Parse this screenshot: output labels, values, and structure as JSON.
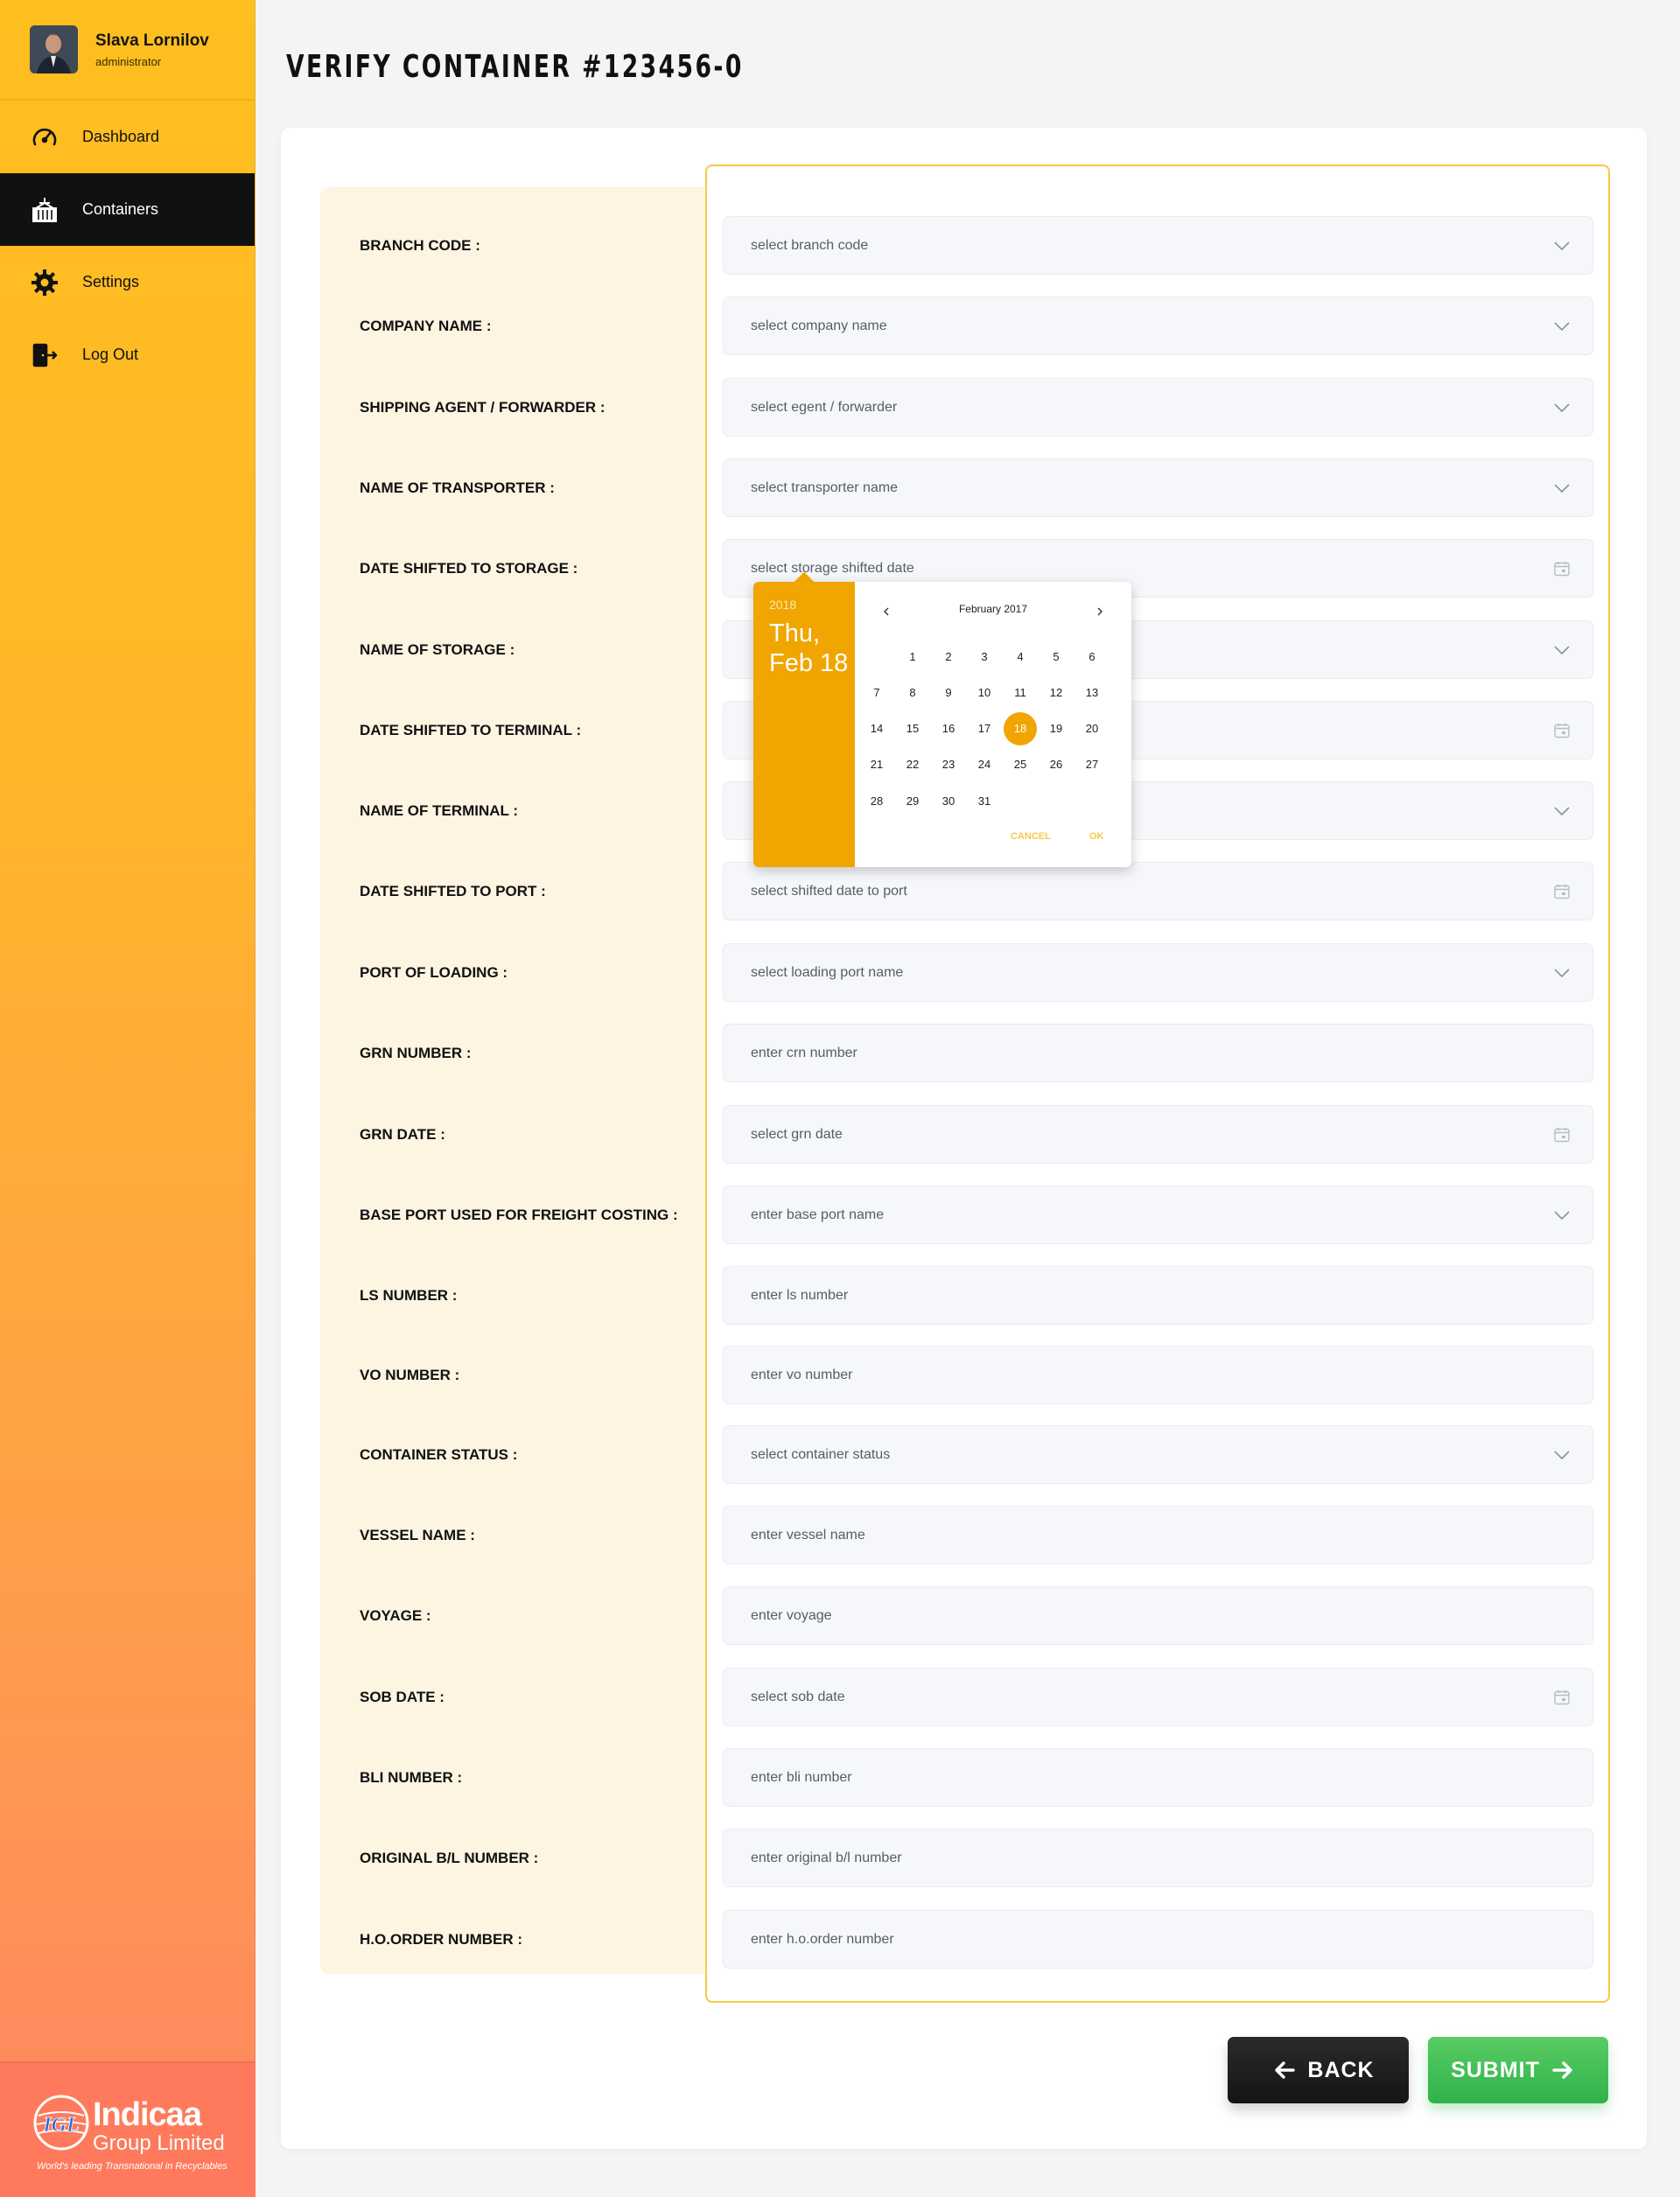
{
  "user": {
    "name": "Slava Lornilov",
    "role": "administrator"
  },
  "nav": [
    {
      "label": "Dashboard",
      "icon": "speedometer-icon",
      "active": false
    },
    {
      "label": "Containers",
      "icon": "container-icon",
      "active": true
    },
    {
      "label": "Settings",
      "icon": "gear-icon",
      "active": false
    },
    {
      "label": "Log Out",
      "icon": "logout-icon",
      "active": false
    }
  ],
  "brand": {
    "name": "Indicaa",
    "subtitle": "Group Limited",
    "tagline": "World's leading Transnational in Recyclables",
    "mark": "IGL"
  },
  "page": {
    "title": "VERIFY CONTAINER #123456-0"
  },
  "form": {
    "rows": [
      {
        "label": "BRANCH CODE :",
        "placeholder": "select branch code",
        "type": "select"
      },
      {
        "label": "COMPANY NAME :",
        "placeholder": "select company name",
        "type": "select"
      },
      {
        "label": "SHIPPING AGENT / FORWARDER :",
        "placeholder": "select egent / forwarder",
        "type": "select"
      },
      {
        "label": "NAME OF TRANSPORTER :",
        "placeholder": "select transporter name",
        "type": "select"
      },
      {
        "label": "DATE SHIFTED TO STORAGE :",
        "placeholder": "select storage shifted date",
        "type": "date"
      },
      {
        "label": "NAME OF STORAGE :",
        "placeholder": "",
        "type": "select"
      },
      {
        "label": "DATE SHIFTED TO TERMINAL :",
        "placeholder": "",
        "type": "date"
      },
      {
        "label": "NAME OF TERMINAL :",
        "placeholder": "",
        "type": "select"
      },
      {
        "label": "DATE SHIFTED TO PORT :",
        "placeholder": "select shifted date to port",
        "type": "date"
      },
      {
        "label": "PORT OF LOADING :",
        "placeholder": "select loading port name",
        "type": "select"
      },
      {
        "label": "GRN NUMBER :",
        "placeholder": "enter crn number",
        "type": "text"
      },
      {
        "label": "GRN DATE :",
        "placeholder": "select grn date",
        "type": "date"
      },
      {
        "label": "BASE PORT USED FOR FREIGHT COSTING :",
        "placeholder": "enter base port name",
        "type": "select"
      },
      {
        "label": "LS NUMBER :",
        "placeholder": "enter ls number",
        "type": "text"
      },
      {
        "label": "VO NUMBER :",
        "placeholder": "enter vo number",
        "type": "text"
      },
      {
        "label": "CONTAINER STATUS :",
        "placeholder": "select container status",
        "type": "select"
      },
      {
        "label": "VESSEL NAME :",
        "placeholder": "enter vessel name",
        "type": "text"
      },
      {
        "label": "VOYAGE :",
        "placeholder": "enter voyage",
        "type": "text"
      },
      {
        "label": "SOB DATE :",
        "placeholder": "select sob date",
        "type": "date"
      },
      {
        "label": "BLI NUMBER :",
        "placeholder": "enter bli number",
        "type": "text"
      },
      {
        "label": "ORIGINAL B/L NUMBER :",
        "placeholder": "enter original b/l number",
        "type": "text"
      },
      {
        "label": "H.O.ORDER NUMBER :",
        "placeholder": "enter h.o.order number",
        "type": "text"
      }
    ]
  },
  "datepicker": {
    "year": "2018",
    "selected_label": "Thu, Feb 18",
    "month_label": "February 2017",
    "prev_icon": "chevron-left-icon",
    "next_icon": "chevron-right-icon",
    "days": [
      "1",
      "2",
      "3",
      "4",
      "5",
      "6",
      "7",
      "8",
      "9",
      "10",
      "11",
      "12",
      "13",
      "14",
      "15",
      "16",
      "17",
      "18",
      "19",
      "20",
      "21",
      "22",
      "23",
      "24",
      "25",
      "26",
      "27",
      "28",
      "29",
      "30",
      "31"
    ],
    "first_weekday_offset": 1,
    "selected_day": "18",
    "cancel_label": "CANCEL",
    "ok_label": "OK"
  },
  "buttons": {
    "back": "BACK",
    "submit": "SUBMIT"
  },
  "colors": {
    "accent": "#f0a500",
    "sidebar_top": "#ffbf1f",
    "sidebar_bottom": "#ff8663",
    "submit": "#3dbb55",
    "back": "#1e1e1e"
  }
}
